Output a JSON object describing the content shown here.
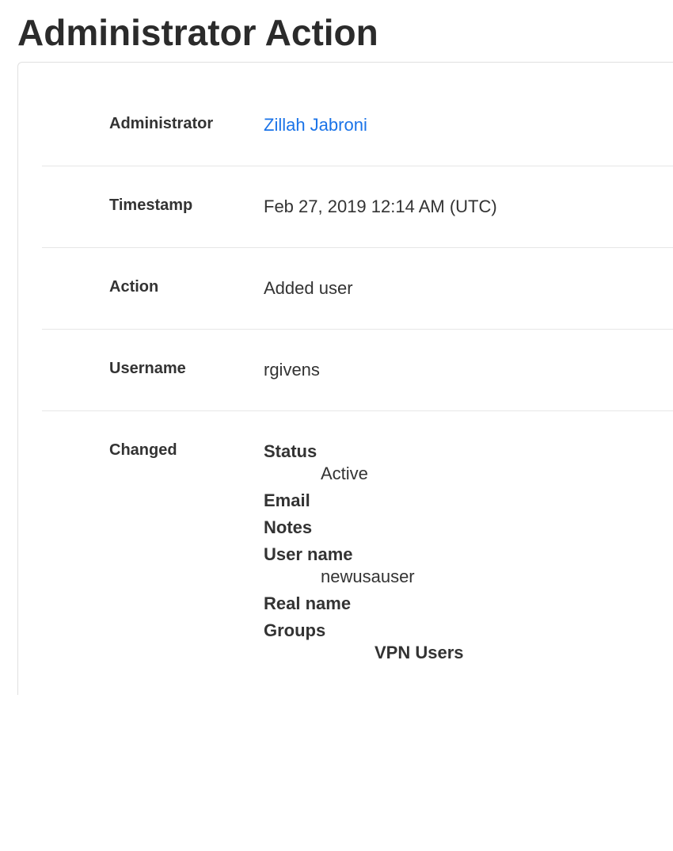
{
  "page_title": "Administrator Action",
  "rows": {
    "administrator": {
      "label": "Administrator",
      "value": "Zillah Jabroni"
    },
    "timestamp": {
      "label": "Timestamp",
      "value": "Feb 27, 2019 12:14 AM (UTC)"
    },
    "action": {
      "label": "Action",
      "value": "Added user"
    },
    "username": {
      "label": "Username",
      "value": "rgivens"
    },
    "changed": {
      "label": "Changed",
      "items": {
        "status": {
          "label": "Status",
          "value": "Active"
        },
        "email": {
          "label": "Email"
        },
        "notes": {
          "label": "Notes"
        },
        "user_name": {
          "label": "User name",
          "value": "newusauser"
        },
        "real_name": {
          "label": "Real name"
        },
        "groups": {
          "label": "Groups",
          "value": "VPN Users"
        }
      }
    }
  }
}
